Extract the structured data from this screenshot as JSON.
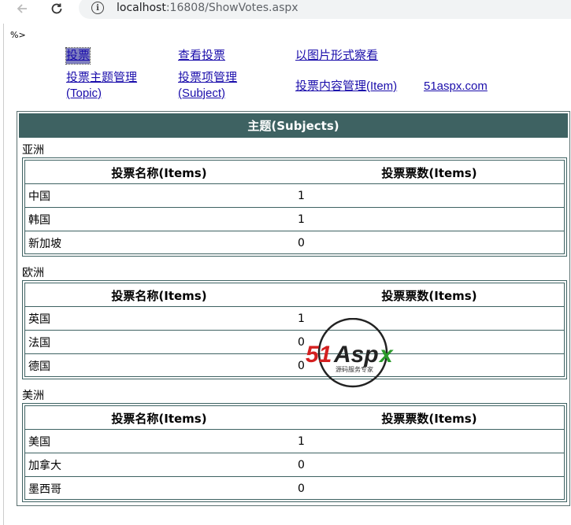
{
  "browser": {
    "url_host": "localhost",
    "url_rest": ":16808/ShowVotes.aspx"
  },
  "page": {
    "stray_text": "%>"
  },
  "nav": {
    "vote": "投票",
    "view_votes": "查看投票",
    "view_as_image": "以图片形式察看",
    "topic_mgmt_line1": "投票主题管理",
    "topic_mgmt_line2": "(Topic)",
    "subject_mgmt_line1": "投票项管理",
    "subject_mgmt_line2": "(Subject)",
    "item_mgmt": "投票内容管理(Item)",
    "site": "51aspx.com"
  },
  "main": {
    "header": "主题(Subjects)",
    "col_name": "投票名称(Items)",
    "col_votes": "投票票数(Items)",
    "groups": [
      {
        "region": "亚洲",
        "items": [
          {
            "name": "中国",
            "votes": "1"
          },
          {
            "name": "韩国",
            "votes": "1"
          },
          {
            "name": "新加坡",
            "votes": "0"
          }
        ]
      },
      {
        "region": "欧洲",
        "items": [
          {
            "name": "英国",
            "votes": "1"
          },
          {
            "name": "法国",
            "votes": "0"
          },
          {
            "name": "德国",
            "votes": "0"
          }
        ]
      },
      {
        "region": "美洲",
        "items": [
          {
            "name": "美国",
            "votes": "1"
          },
          {
            "name": "加拿大",
            "votes": "0"
          },
          {
            "name": "墨西哥",
            "votes": "0"
          }
        ]
      }
    ]
  },
  "watermark": {
    "logo": "51Aspx",
    "tagline": "源码服务专家"
  },
  "colors": {
    "header_bg": "#3e6262",
    "link": "#1a0dab",
    "logo_red": "#d42020",
    "logo_green": "#2a9a2a"
  }
}
